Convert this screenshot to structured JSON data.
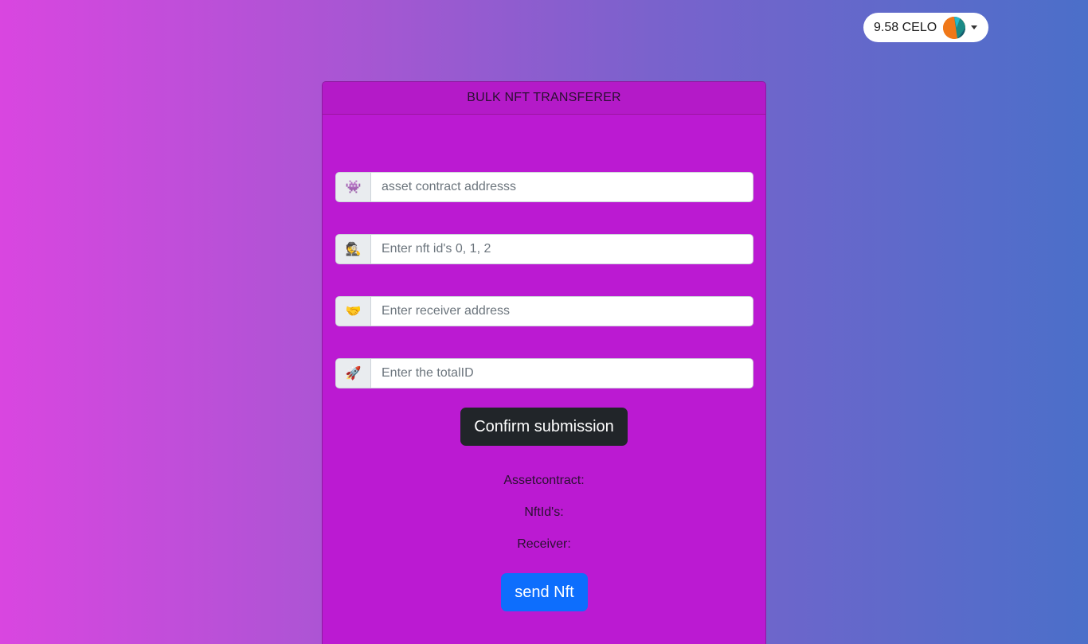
{
  "wallet": {
    "balance": "9.58 CELO",
    "avatar_icon": "wallet-avatar-icon",
    "dropdown_icon": "caret-down-icon"
  },
  "card": {
    "title": "BULK NFT TRANSFERER",
    "fields": [
      {
        "icon": "👾",
        "icon_name": "alien-monster-icon",
        "value": "",
        "placeholder": "asset contract addresss"
      },
      {
        "icon": "🕵️",
        "icon_name": "detective-icon",
        "value": "",
        "placeholder": "Enter nft id's 0, 1, 2"
      },
      {
        "icon": "🤝",
        "icon_name": "handshake-icon",
        "value": "",
        "placeholder": "Enter receiver address"
      },
      {
        "icon": "🚀",
        "icon_name": "rocket-icon",
        "value": "",
        "placeholder": "Enter the totalID"
      }
    ],
    "confirm_label": "Confirm submission",
    "summary": {
      "asset_contract": "Assetcontract:",
      "nft_ids": "NftId's:",
      "receiver": "Receiver:"
    },
    "send_label": "send Nft"
  },
  "colors": {
    "card_bg": "#bb1ad2",
    "confirm_button": "#212529",
    "send_button": "#0d6efd"
  }
}
